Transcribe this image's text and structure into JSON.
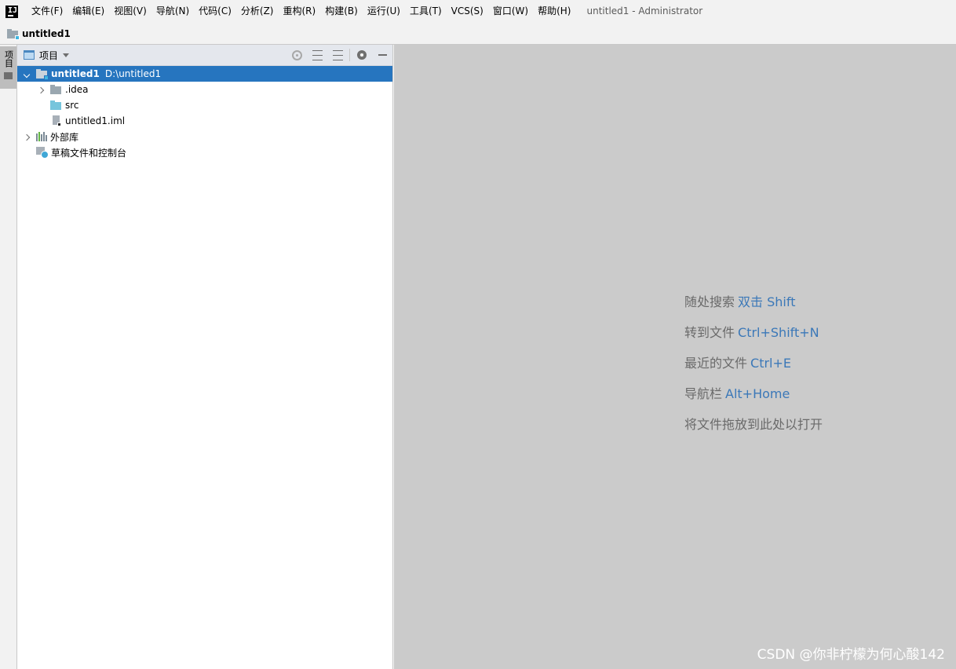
{
  "menubar": {
    "items": [
      "文件(F)",
      "编辑(E)",
      "视图(V)",
      "导航(N)",
      "代码(C)",
      "分析(Z)",
      "重构(R)",
      "构建(B)",
      "运行(U)",
      "工具(T)",
      "VCS(S)",
      "窗口(W)",
      "帮助(H)"
    ],
    "window_title": "untitled1 - Administrator",
    "logo_text": "IJ"
  },
  "navbar": {
    "project_name": "untitled1"
  },
  "toolstrip": {
    "project_tab": "项目"
  },
  "project_panel": {
    "title": "项目",
    "tree": {
      "root": {
        "name": "untitled1",
        "path": "D:\\untitled1"
      },
      "idea": ".idea",
      "src": "src",
      "iml": "untitled1.iml",
      "external_libraries": "外部库",
      "scratches": "草稿文件和控制台"
    }
  },
  "editor": {
    "hints": [
      {
        "text": "随处搜索",
        "key": "双击 Shift"
      },
      {
        "text": "转到文件",
        "key": "Ctrl+Shift+N"
      },
      {
        "text": "最近的文件",
        "key": "Ctrl+E"
      },
      {
        "text": "导航栏",
        "key": "Alt+Home"
      },
      {
        "text": "将文件拖放到此处以打开",
        "key": ""
      }
    ],
    "watermark": "CSDN @你非柠檬为何心酸142"
  },
  "colors": {
    "selection": "#2675bf",
    "shortcut": "#3b78b8",
    "editor_bg": "#cbcbcb"
  }
}
